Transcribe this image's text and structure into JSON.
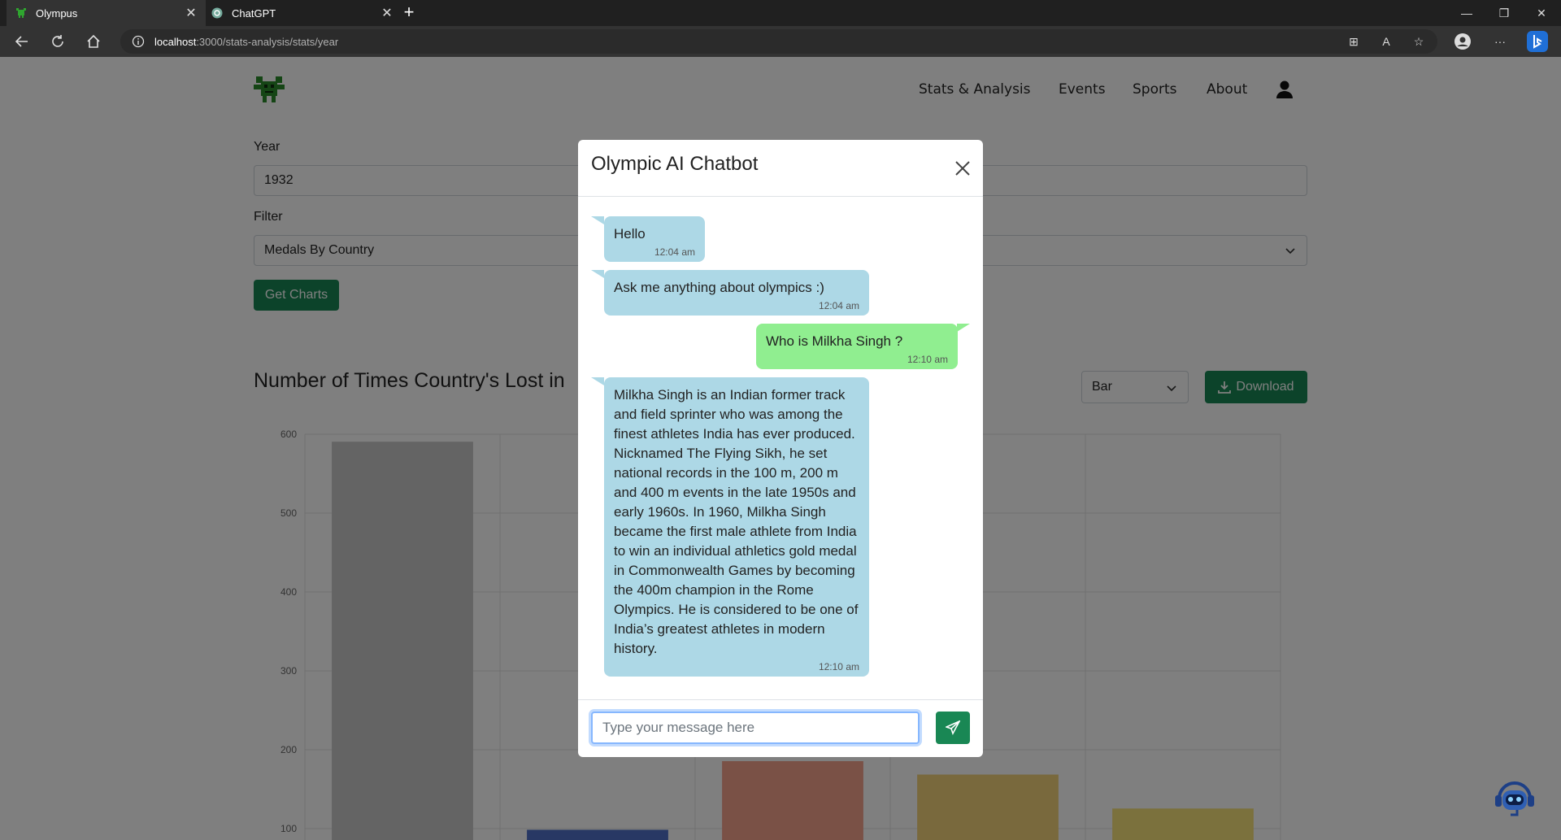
{
  "browser": {
    "tabs": [
      {
        "title": "Olympus",
        "icon": "olympus-favicon"
      },
      {
        "title": "ChatGPT",
        "icon": "chatgpt-favicon"
      }
    ],
    "url_host": "localhost",
    "url_path": ":3000/stats-analysis/stats/year"
  },
  "navbar": {
    "logo": "green-robot-logo",
    "links": [
      "Stats & Analysis",
      "Events",
      "Sports",
      "About"
    ],
    "user_icon": "user-icon"
  },
  "form": {
    "year_label": "Year",
    "year_value": "1932",
    "filter_label": "Filter",
    "filter_value": "Medals By Country",
    "get_charts_label": "Get Charts"
  },
  "chart_section": {
    "title": "Number of Times Country's Lost in",
    "type_value": "Bar",
    "download_label": "Download"
  },
  "chart_data": {
    "type": "bar",
    "categories": [
      "",
      "",
      "",
      "",
      ""
    ],
    "values": [
      590,
      98,
      185,
      168,
      125
    ],
    "colors": [
      "#c8c8c8",
      "#5070c8",
      "#f4a28c",
      "#f2d27a",
      "#f7e27a"
    ],
    "ylim": [
      90,
      600
    ],
    "yticks": [
      "600",
      "500",
      "400",
      "300",
      "200",
      "100"
    ],
    "grid": true
  },
  "chatbot": {
    "title": "Olympic AI Chatbot",
    "messages": [
      {
        "from": "bot",
        "text": "Hello",
        "time": "12:04 am"
      },
      {
        "from": "bot",
        "text": "Ask me anything about olympics :)",
        "time": "12:04 am"
      },
      {
        "from": "user",
        "text": "Who is Milkha Singh ?",
        "time": "12:10 am"
      },
      {
        "from": "bot",
        "text": "Milkha Singh is an Indian former track and field sprinter who was among the finest athletes India has ever produced. Nicknamed The Flying Sikh, he set national records in the 100 m, 200 m and 400 m events in the late 1950s and early 1960s. In 1960, Milkha Singh became the first male athlete from India to win an individual athletics gold medal in Commonwealth Games by becoming the 400m champion in the Rome Olympics. He is considered to be one of India’s greatest athletes in modern history.",
        "time": "12:10 am"
      }
    ],
    "input_placeholder": "Type your message here",
    "send_icon": "paper-plane-icon"
  },
  "colors": {
    "accent_green": "#198754",
    "bot_bubble": "#add8e6",
    "user_bubble": "#90ee90"
  }
}
